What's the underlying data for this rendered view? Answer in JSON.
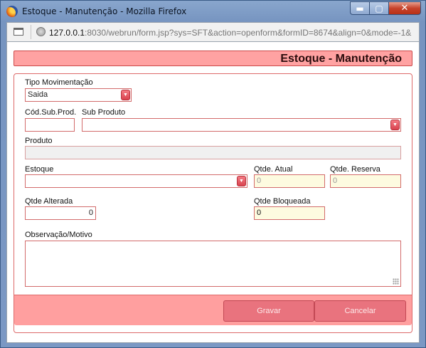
{
  "window": {
    "title": "Estoque - Manutenção - Mozilla Firefox",
    "buttons": {
      "minimize": "▬",
      "maximize": "▢",
      "close": "✕"
    }
  },
  "address_bar": {
    "host": "127.0.0.1",
    "rest": ":8030/webrun/form.jsp?sys=SFT&action=openform&formID=8674&align=0&mode=-1&"
  },
  "form": {
    "title": "Estoque - Manutenção",
    "tipo_movimentacao": {
      "label": "Tipo Movimentação",
      "value": "Saida"
    },
    "cod_sub_prod": {
      "label": "Cód.Sub.Prod.",
      "value": ""
    },
    "sub_produto": {
      "label": "Sub Produto",
      "value": ""
    },
    "produto": {
      "label": "Produto",
      "value": ""
    },
    "estoque": {
      "label": "Estoque",
      "value": ""
    },
    "qtde_atual": {
      "label": "Qtde. Atual",
      "value": "0"
    },
    "qtde_reserva": {
      "label": "Qtde. Reserva",
      "value": "0"
    },
    "qtde_alterada": {
      "label": "Qtde Alterada",
      "value": "0"
    },
    "qtde_bloqueada": {
      "label": "Qtde Bloqueada",
      "value": "0"
    },
    "observacao": {
      "label": "Observação/Motivo",
      "value": ""
    }
  },
  "footer": {
    "save_label": "Gravar",
    "cancel_label": "Cancelar"
  },
  "colors": {
    "accent": "#ffa2a2",
    "border": "#dd6a6a",
    "button": "#e9737e",
    "readonly_bg": "#fdfbe0"
  },
  "icons": {
    "app": "firefox-icon",
    "page": "page-icon",
    "security": "globe-icon",
    "dropdown": "chevron-down-icon",
    "resize": "resize-grip-icon"
  }
}
